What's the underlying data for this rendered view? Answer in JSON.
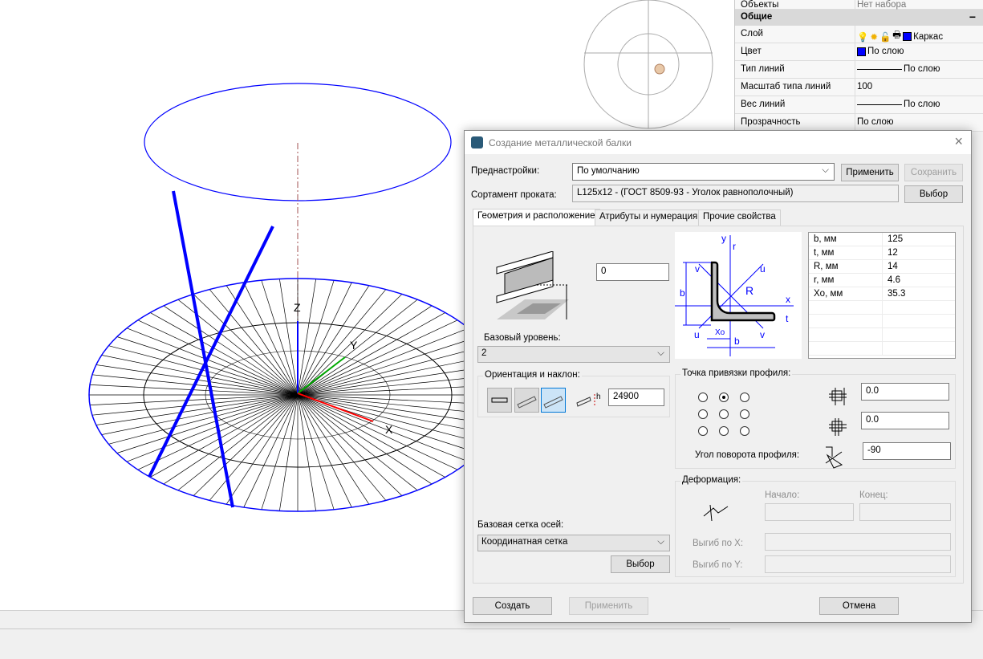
{
  "viewport": {
    "axis_labels": [
      "Z",
      "Y",
      "X"
    ],
    "colors": {
      "blue_lines": "#0000ff",
      "wire": "#000000",
      "axis_y": "#00aa00",
      "axis_x": "#ff0000"
    }
  },
  "properties": {
    "top_row": {
      "key": "Объекты",
      "value": "Нет набора"
    },
    "section": "Общие",
    "collapse_icon": "−",
    "rows": [
      {
        "key": "Слой",
        "value": "Каркас"
      },
      {
        "key": "Цвет",
        "value": "По слою"
      },
      {
        "key": "Тип линий",
        "value": "По слою"
      },
      {
        "key": "Масштаб типа линий",
        "value": "100"
      },
      {
        "key": "Вес линий",
        "value": "По слою"
      },
      {
        "key": "Прозрачность",
        "value": "По слою"
      }
    ],
    "layer_color": "#0000ff"
  },
  "dialog": {
    "title": "Создание металлической балки",
    "close": "×",
    "presets_label": "Преднастройки:",
    "presets_value": "По умолчанию",
    "apply_preset": "Применить",
    "save_preset": "Сохранить",
    "assortment_label": "Сортамент проката:",
    "assortment_value": "L125x12 - (ГОСТ 8509-93 - Уголок равнополочный)",
    "choose": "Выбор",
    "tabs": [
      "Геометрия и расположение",
      "Атрибуты и нумерация",
      "Прочие свойства"
    ],
    "offset_value": "0",
    "base_level_label": "Базовый уровень:",
    "base_level_value": "2",
    "orientation_label": "Ориентация и наклон:",
    "height_value": "24900",
    "height_icon_label": "h",
    "grid_label": "Базовая сетка осей:",
    "grid_value": "Координатная сетка",
    "grid_choose": "Выбор",
    "section_labels": {
      "y": "y",
      "x": "x",
      "u": "u",
      "v": "v",
      "b": "b",
      "t": "t",
      "r": "r",
      "R": "R",
      "xo": "Xo"
    },
    "params": [
      {
        "name": "b, мм",
        "value": "125"
      },
      {
        "name": "t, мм",
        "value": "12"
      },
      {
        "name": "R, мм",
        "value": "14"
      },
      {
        "name": "r, мм",
        "value": "4.6"
      },
      {
        "name": "Xo, мм",
        "value": "35.3"
      }
    ],
    "anchor_label": "Точка привязки профиля:",
    "anchor_selected": "top-center",
    "offset_x": "0.0",
    "offset_y": "0.0",
    "rotation_label": "Угол поворота профиля:",
    "rotation_value": "-90",
    "deform_label": "Деформация:",
    "start_label": "Начало:",
    "end_label": "Конец:",
    "bend_x_label": "Выгиб по X:",
    "bend_y_label": "Выгиб по Y:",
    "create": "Создать",
    "apply": "Применить",
    "cancel": "Отмена"
  }
}
